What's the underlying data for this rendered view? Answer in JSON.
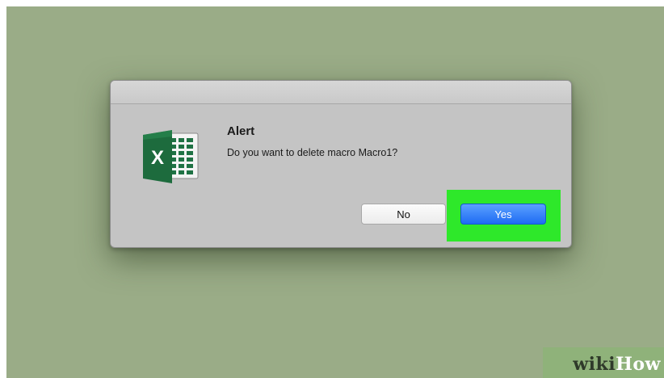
{
  "dialog": {
    "title": "Alert",
    "message": "Do you want to delete macro Macro1?",
    "buttons": {
      "no_label": "No",
      "yes_label": "Yes"
    },
    "app_icon": "excel-icon",
    "highlight_color": "#2ee82a"
  },
  "watermark": {
    "wiki": "wiki",
    "how": "How"
  },
  "colors": {
    "background": "#9aac87",
    "dialog": "#c4c4c4",
    "primary_button": "#1e6cf3"
  }
}
